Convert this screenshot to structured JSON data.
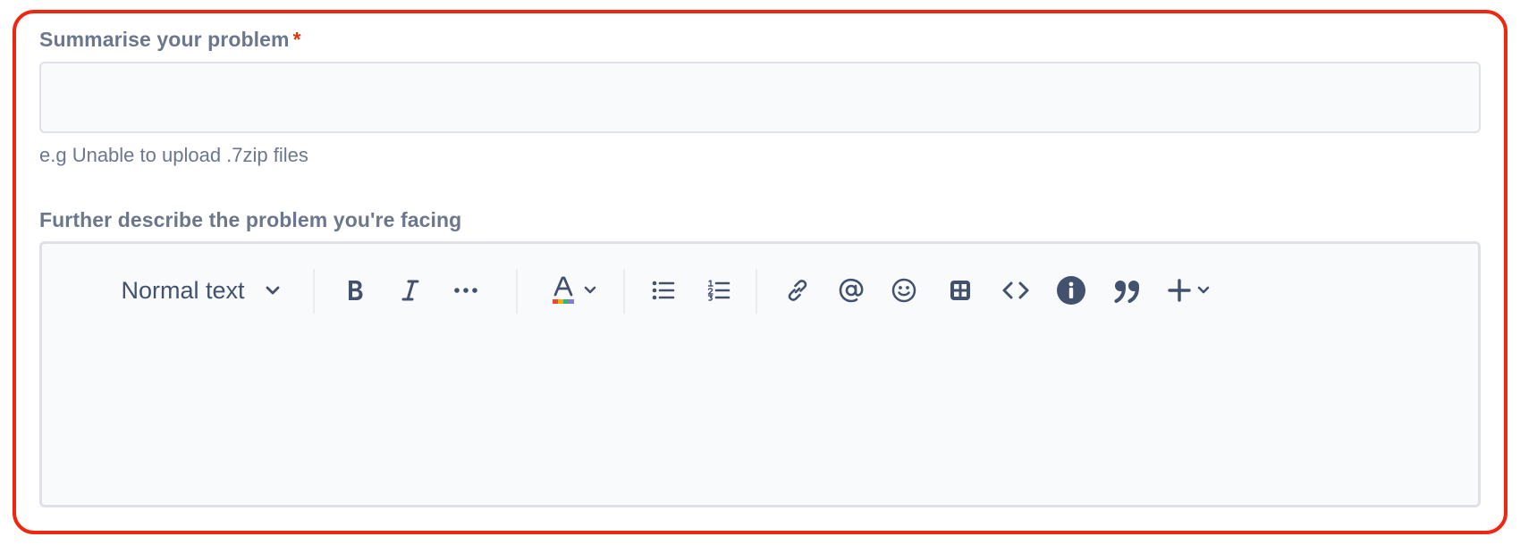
{
  "summary": {
    "label": "Summarise your problem",
    "required_marker": "*",
    "value": "",
    "placeholder": "",
    "helper": "e.g Unable to upload .7zip files"
  },
  "description": {
    "label": "Further describe the problem you're facing",
    "editor_content": ""
  },
  "toolbar": {
    "text_style": "Normal text",
    "icons": [
      "chevron-down-icon",
      "bold-icon",
      "italic-icon",
      "more-formatting-icon",
      "text-color-icon",
      "bullet-list-icon",
      "numbered-list-icon",
      "link-icon",
      "mention-icon",
      "emoji-icon",
      "table-icon",
      "code-icon",
      "info-panel-icon",
      "quote-icon",
      "insert-icon"
    ]
  },
  "colors": {
    "frame_border": "#f0270f",
    "label": "#6b778c",
    "required": "#de350b",
    "icon": "#42526e",
    "field_bg": "#f9fafc",
    "field_border": "#dfe1e6"
  }
}
